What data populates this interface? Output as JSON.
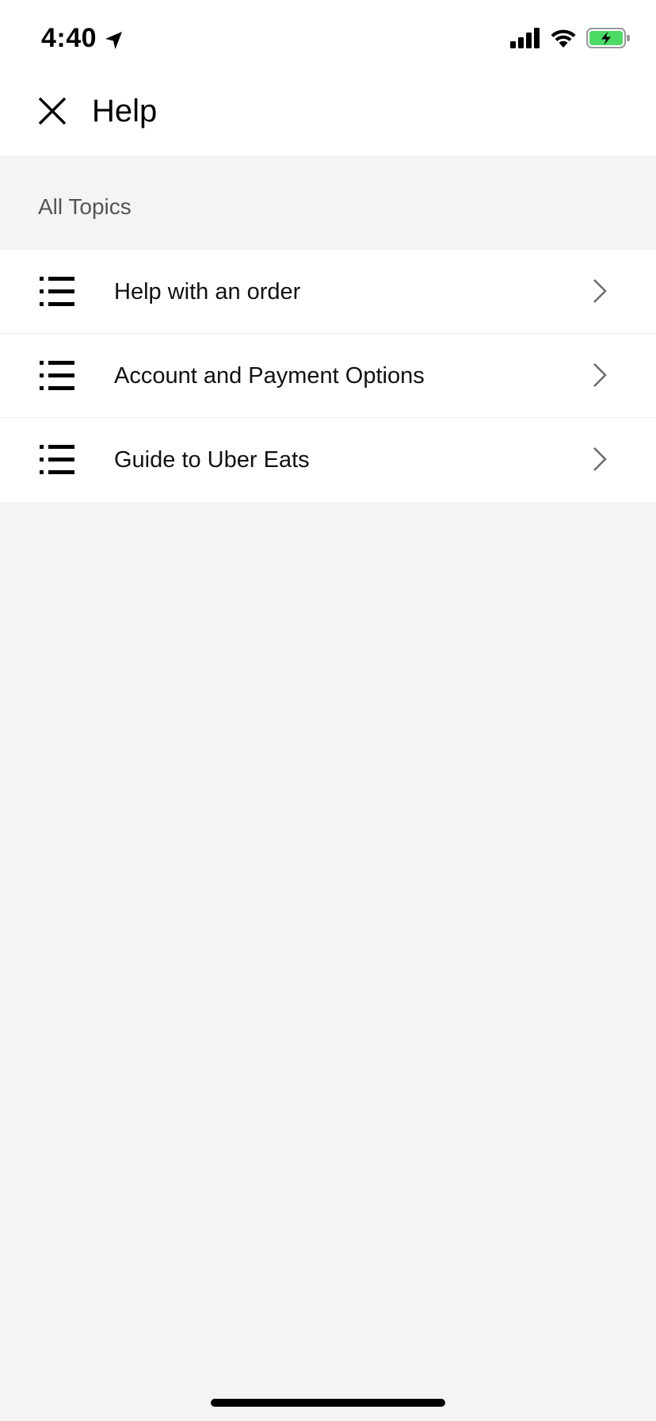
{
  "status_bar": {
    "time": "4:40",
    "location_icon": "location-arrow-icon",
    "signal_icon": "cellular-signal-icon",
    "wifi_icon": "wifi-icon",
    "battery_icon": "battery-charging-icon",
    "battery_color": "#4cd964"
  },
  "header": {
    "close_icon": "close-icon",
    "title": "Help"
  },
  "section": {
    "label": "All Topics"
  },
  "topics": [
    {
      "label": "Help with an order",
      "icon": "list-icon",
      "chevron": "chevron-right-icon"
    },
    {
      "label": "Account and Payment Options",
      "icon": "list-icon",
      "chevron": "chevron-right-icon"
    },
    {
      "label": "Guide to Uber Eats",
      "icon": "list-icon",
      "chevron": "chevron-right-icon"
    }
  ],
  "colors": {
    "background": "#f4f4f4",
    "surface": "#ffffff",
    "text": "#000000",
    "secondary_text": "#545454"
  }
}
